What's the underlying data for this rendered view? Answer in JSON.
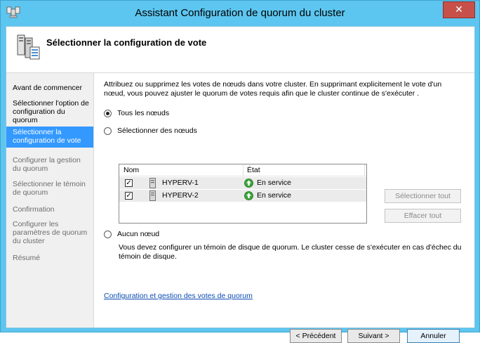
{
  "window": {
    "title": "Assistant Configuration de quorum du cluster",
    "close_label": "✕"
  },
  "header": {
    "title": "Sélectionner la configuration de vote"
  },
  "nav": {
    "items": [
      {
        "label": "Avant de commencer",
        "state": "normal"
      },
      {
        "label": "Sélectionner l'option de configuration du quorum",
        "state": "normal"
      },
      {
        "label": "Sélectionner la configuration de vote",
        "state": "selected"
      },
      {
        "label": "Configurer la gestion du quorum",
        "state": "disabled"
      },
      {
        "label": "Sélectionner le témoin de quorum",
        "state": "disabled"
      },
      {
        "label": "Confirmation",
        "state": "disabled"
      },
      {
        "label": "Configurer les paramètres de quorum du cluster",
        "state": "disabled"
      },
      {
        "label": "Résumé",
        "state": "disabled"
      }
    ]
  },
  "content": {
    "description": "Attribuez ou supprimez les votes de nœuds dans votre cluster. En supprimant explicitement le vote d'un nœud, vous pouvez ajuster le quorum de votes requis afin que le cluster continue de s'exécuter .",
    "options": {
      "all": "Tous les nœuds",
      "select": "Sélectionner des nœuds",
      "none": "Aucun nœud"
    },
    "selected_option": "all",
    "node_list": {
      "columns": {
        "name": "Nom",
        "state": "État"
      },
      "rows": [
        {
          "name": "HYPERV-1",
          "state": "En service",
          "checked": true
        },
        {
          "name": "HYPERV-2",
          "state": "En service",
          "checked": true
        }
      ]
    },
    "select_all_label": "Sélectionner tout",
    "clear_all_label": "Effacer tout",
    "none_description": "Vous devez configurer un témoin de disque de quorum. Le cluster cesse de s'exécuter en cas d'échec du témoin de disque.",
    "help_link": "Configuration et gestion des votes de quorum"
  },
  "footer": {
    "previous_label": "< Précédent",
    "next_label": "Suivant >",
    "cancel_label": "Annuler"
  },
  "colors": {
    "titlebar": "#5dc6f0",
    "close": "#c7514a",
    "nav_selected": "#3399ff",
    "link": "#0b4bb3"
  }
}
